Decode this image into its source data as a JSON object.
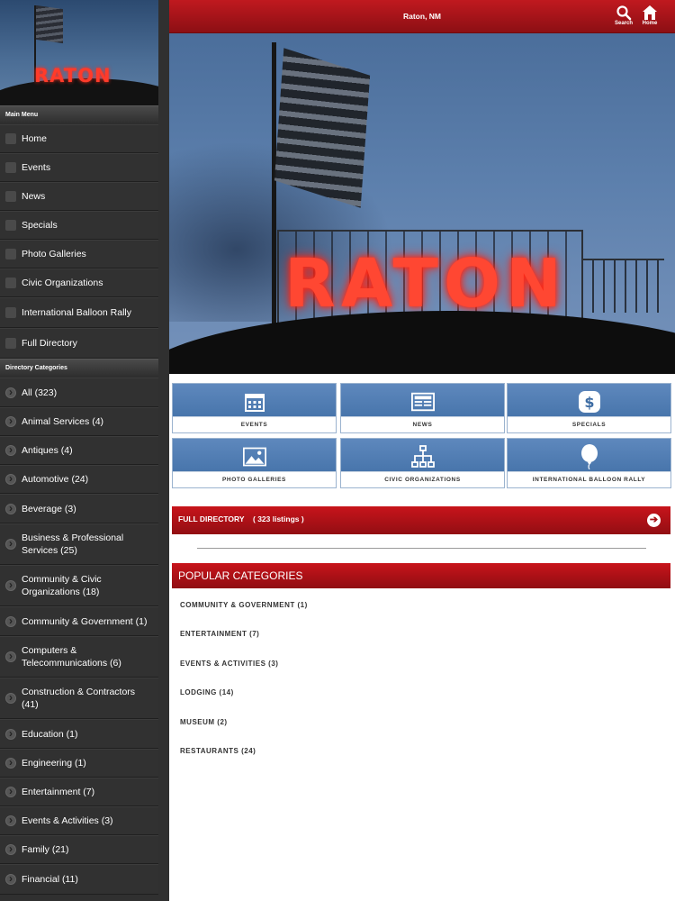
{
  "header": {
    "title": "Raton, NM",
    "search_label": "Search",
    "home_label": "Home"
  },
  "sidebar": {
    "hero_sign": "RATON",
    "main_menu_label": "Main Menu",
    "main_menu": [
      {
        "label": "Home",
        "icon": "home-icon"
      },
      {
        "label": "Events",
        "icon": "calendar-icon"
      },
      {
        "label": "News",
        "icon": "newspaper-icon"
      },
      {
        "label": "Specials",
        "icon": "dollar-icon"
      },
      {
        "label": "Photo Galleries",
        "icon": "image-icon"
      },
      {
        "label": "Civic Organizations",
        "icon": "org-chart-icon"
      },
      {
        "label": "International Balloon Rally",
        "icon": "balloon-icon"
      },
      {
        "label": "Full Directory",
        "icon": "list-icon"
      }
    ],
    "categories_label": "Directory Categories",
    "categories": [
      {
        "label": "All (323)"
      },
      {
        "label": "Animal Services (4)"
      },
      {
        "label": "Antiques (4)"
      },
      {
        "label": "Automotive (24)"
      },
      {
        "label": "Beverage (3)"
      },
      {
        "label": "Business & Professional Services (25)"
      },
      {
        "label": "Community & Civic Organizations (18)"
      },
      {
        "label": "Community & Government (1)"
      },
      {
        "label": "Computers & Telecommunications (6)"
      },
      {
        "label": "Construction & Contractors (41)"
      },
      {
        "label": "Education (1)"
      },
      {
        "label": "Engineering (1)"
      },
      {
        "label": "Entertainment (7)"
      },
      {
        "label": "Events & Activities (3)"
      },
      {
        "label": "Family (21)"
      },
      {
        "label": "Financial (11)"
      }
    ]
  },
  "hero": {
    "sign": "RATON"
  },
  "tiles": [
    {
      "label": "EVENTS",
      "icon": "calendar-icon"
    },
    {
      "label": "NEWS",
      "icon": "newspaper-icon"
    },
    {
      "label": "SPECIALS",
      "icon": "dollar-icon"
    },
    {
      "label": "PHOTO GALLERIES",
      "icon": "image-icon"
    },
    {
      "label": "CIVIC ORGANIZATIONS",
      "icon": "org-chart-icon"
    },
    {
      "label": "INTERNATIONAL BALLOON RALLY",
      "icon": "balloon-icon"
    }
  ],
  "full_directory": {
    "label": "FULL DIRECTORY",
    "count": "( 323 listings )"
  },
  "popular": {
    "title": "POPULAR CATEGORIES",
    "items": [
      "COMMUNITY & GOVERNMENT (1)",
      "ENTERTAINMENT (7)",
      "EVENTS & ACTIVITIES (3)",
      "LODGING (14)",
      "MUSEUM (2)",
      "RESTAURANTS (24)"
    ]
  },
  "colors": {
    "brand_red": "#b3131a",
    "tile_blue": "#4f7bb2",
    "sidebar_bg": "#303030"
  }
}
